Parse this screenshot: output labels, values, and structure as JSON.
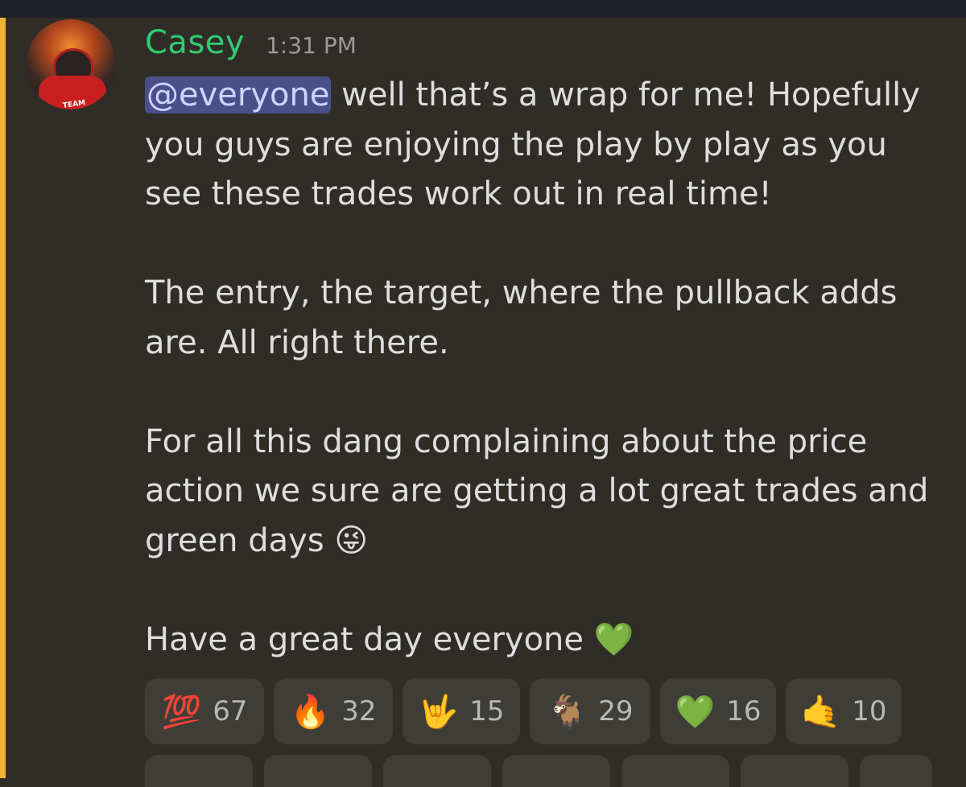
{
  "message": {
    "author": "Casey",
    "timestamp": "1:31 PM",
    "mention": "@everyone",
    "paragraphs": [
      " well that’s a wrap for me! Hopefully you guys are enjoying the play by play as you see these trades work out in real time!",
      "The entry, the target, where the pullback adds are. All right there.",
      "For all this dang complaining about the price action we sure are getting a lot great trades and green days 😜",
      "Have a great day everyone 💚"
    ]
  },
  "colors": {
    "username": "#2fcc71",
    "mention_bg": "#4a4f8a",
    "mention_stripe": "#f0b232",
    "background": "#302d28"
  },
  "reactions": [
    {
      "emoji": "💯",
      "count": "67"
    },
    {
      "emoji": "🔥",
      "count": "32"
    },
    {
      "emoji": "🤟",
      "count": "15"
    },
    {
      "emoji": "🐐",
      "count": "29"
    },
    {
      "emoji": "💚",
      "count": "16"
    },
    {
      "emoji": "🤙",
      "count": "10"
    }
  ],
  "avatar": {
    "badge_text": "TEAM"
  }
}
